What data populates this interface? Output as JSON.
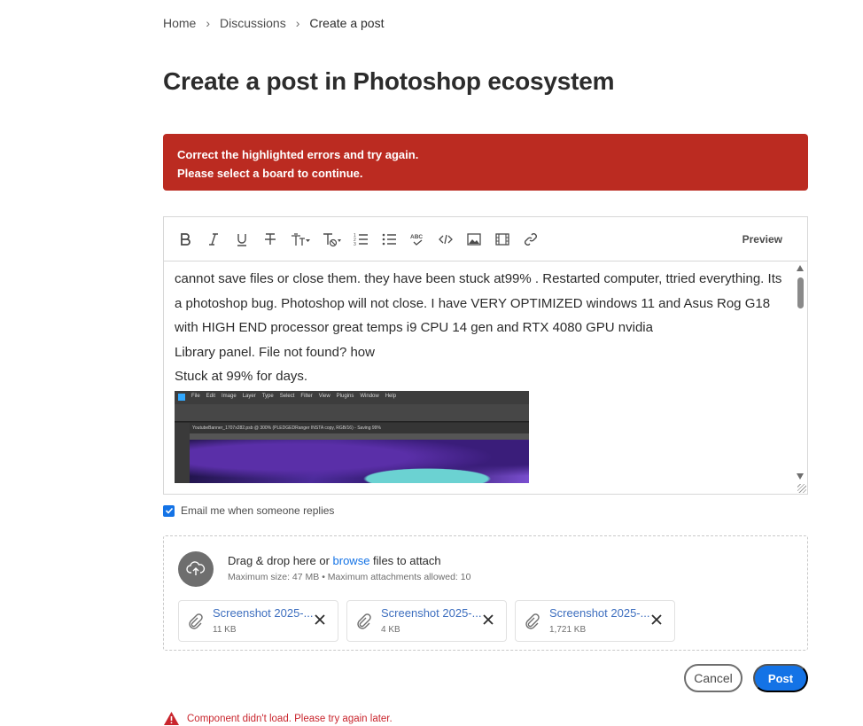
{
  "breadcrumb": {
    "items": [
      "Home",
      "Discussions"
    ],
    "current": "Create a post",
    "separator": "›"
  },
  "page_title": "Create a post in Photoshop ecosystem",
  "error_banner": {
    "line1": "Correct the highlighted errors and try again.",
    "line2": "Please select a board to continue.",
    "color": "#bb2b21"
  },
  "toolbar": {
    "icons": [
      "bold-icon",
      "italic-icon",
      "underline-icon",
      "strikethrough-icon",
      "text-size-icon",
      "clear-format-icon",
      "numbered-list-icon",
      "bullet-list-icon",
      "spellcheck-icon",
      "code-icon",
      "image-icon",
      "video-icon",
      "link-icon"
    ],
    "preview_label": "Preview"
  },
  "editor": {
    "paragraphs": [
      "cannot save files or close them. they have been stuck at99% . Restarted computer, ttried everything. Its a photoshop bug. Photoshop will not close. I have VERY OPTIMIZED windows 11 and Asus Rog G18 with HIGH END processor great temps i9 CPU 14 gen and RTX 4080 GPU nvidia",
      "Library panel. File not found? how",
      "Stuck at 99% for days."
    ],
    "embedded_screenshot": {
      "menu_items": [
        "File",
        "Edit",
        "Image",
        "Layer",
        "Type",
        "Select",
        "Filter",
        "View",
        "Plugins",
        "Window",
        "Help"
      ],
      "doc_tab": "YoutubeBanner_1707x282.psb @ 300% (PLEDGEDRanger INSTA copy, RGB/16) - Saving 99%"
    }
  },
  "email_option": {
    "label": "Email me when someone replies",
    "checked": true
  },
  "attachments": {
    "drop_prefix": "Drag & drop here or ",
    "browse_label": "browse",
    "drop_suffix": " files to attach",
    "hint": "Maximum size: 47 MB • Maximum attachments allowed: 10",
    "files": [
      {
        "name": "Screenshot 2025-...",
        "size": "11 KB"
      },
      {
        "name": "Screenshot 2025-...",
        "size": "4 KB"
      },
      {
        "name": "Screenshot 2025-...",
        "size": "1,721 KB"
      }
    ]
  },
  "actions": {
    "cancel_label": "Cancel",
    "post_label": "Post"
  },
  "component_error": "Component didn't load. Please try again later.",
  "colors": {
    "accent": "#1473e6",
    "error": "#c9252d"
  }
}
